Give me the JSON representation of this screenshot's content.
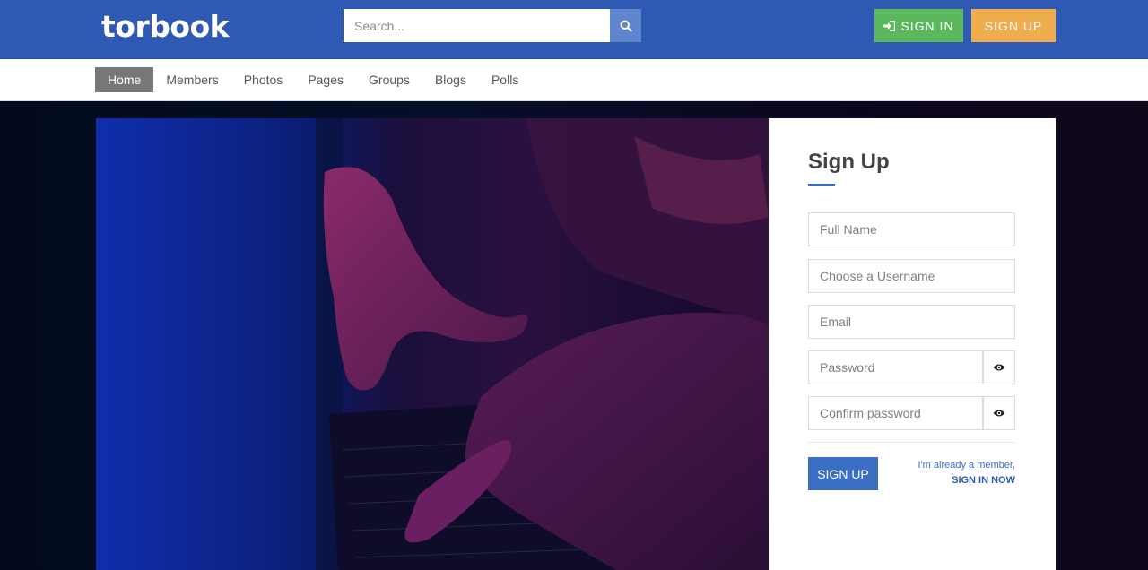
{
  "header": {
    "logo": "torbook",
    "search_placeholder": "Search...",
    "sign_in_label": "SIGN IN",
    "sign_up_label": "SIGN UP"
  },
  "nav": {
    "items": [
      "Home",
      "Members",
      "Photos",
      "Pages",
      "Groups",
      "Blogs",
      "Polls"
    ],
    "active": "Home"
  },
  "signup_form": {
    "title": "Sign Up",
    "full_name_placeholder": "Full Name",
    "username_placeholder": "Choose a Username",
    "email_placeholder": "Email",
    "password_placeholder": "Password",
    "confirm_password_placeholder": "Confirm password",
    "submit_label": "SIGN UP",
    "already_member_text": "I'm already a member,",
    "sign_in_now_label": "SIGN IN NOW"
  },
  "colors": {
    "header_bg": "#2f5ab4",
    "sign_in_bg": "#5cb85c",
    "sign_up_bg": "#f0ad4e",
    "accent": "#3a6fc4",
    "nav_active_bg": "#777777"
  },
  "icons": {
    "search": "search-icon",
    "sign_in": "sign-in-icon",
    "password_toggle": "eye-icon"
  }
}
